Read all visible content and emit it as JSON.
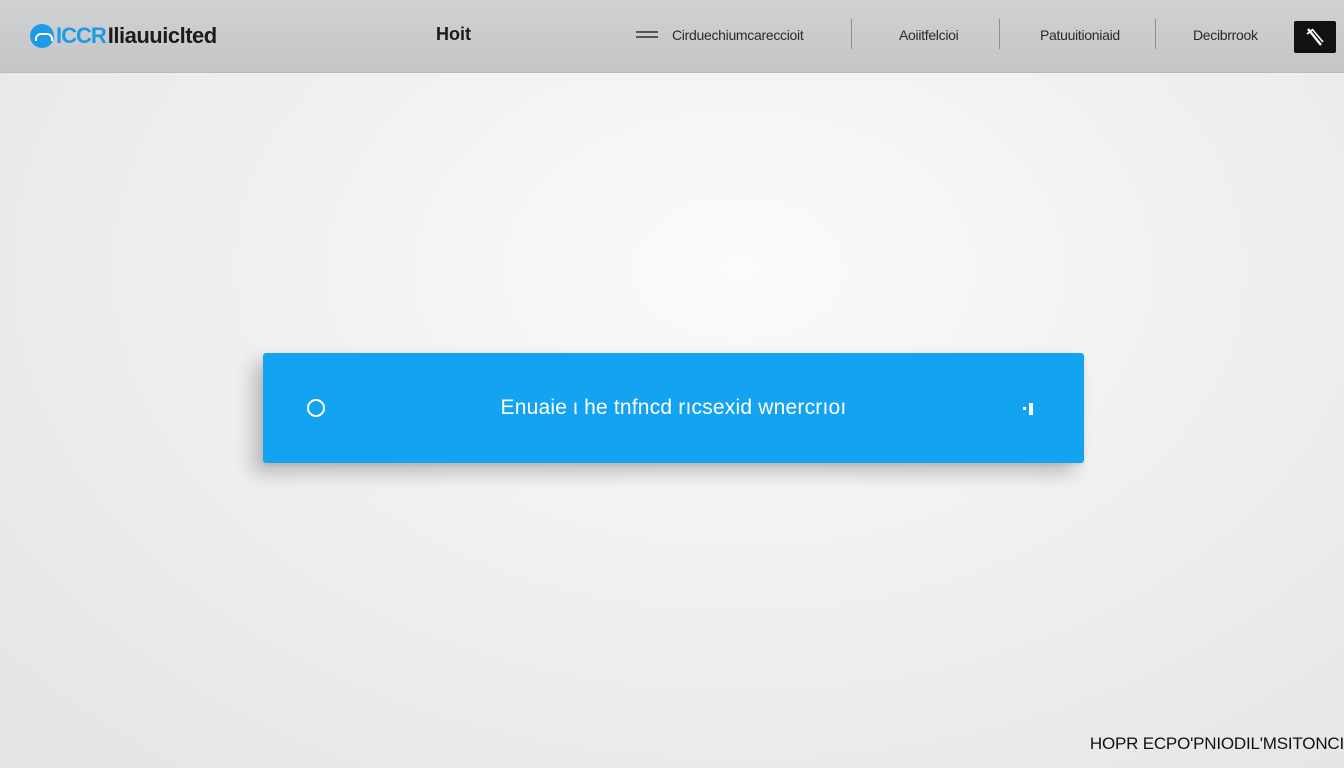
{
  "header": {
    "logo_blue": "ICCR",
    "logo_dark": "Iliauuiclted",
    "home": "Hoit",
    "nav": [
      "Cirduechiumcareccioit",
      "Aoiitfelcioi",
      "Patuuitioniaid",
      "Decibrrook"
    ]
  },
  "panel": {
    "text": "Enuaie ι he tnfncd rıcsexid wnercrıoı",
    "accent": "#13a3f0"
  },
  "footer": {
    "text": "HOPR ECPO'PNIODIL'MSITONCI"
  },
  "icons": {
    "logo": "logo-mark-icon",
    "menu": "menu-icon",
    "edit": "edit-icon",
    "radio": "radio-icon",
    "side": "side-indicator-icon"
  }
}
